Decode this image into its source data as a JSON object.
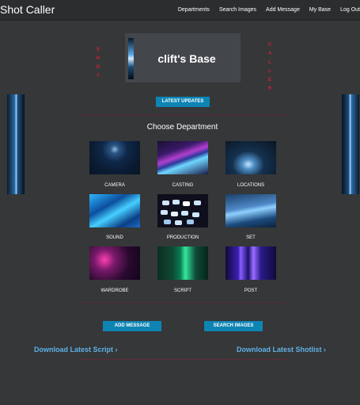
{
  "navbar": {
    "brand": "Shot Caller",
    "links": [
      "Departments",
      "Search Images",
      "Add Message",
      "My Base",
      "Log Out"
    ]
  },
  "side_text": {
    "left": [
      "S",
      "H",
      "O",
      "T"
    ],
    "right": [
      "C",
      "A",
      "L",
      "L",
      "E",
      "R"
    ]
  },
  "base": {
    "title": "clift's Base"
  },
  "buttons": {
    "latest_updates": "LATEST UPDATES",
    "add_message": "ADD MESSAGE",
    "search_images": "SEARCH IMAGES"
  },
  "departments": {
    "heading": "Choose Department",
    "items": [
      {
        "label": "CAMERA"
      },
      {
        "label": "CASTING"
      },
      {
        "label": "LOCATIONS"
      },
      {
        "label": "SOUND"
      },
      {
        "label": "PRODUCTION"
      },
      {
        "label": "SET"
      },
      {
        "label": "WARDROBE"
      },
      {
        "label": "SCRIPT"
      },
      {
        "label": "POST"
      }
    ]
  },
  "downloads": {
    "script": "Download Latest Script",
    "shotlist": "Download Latest Shotlist",
    "chevron": "›"
  },
  "colors": {
    "background": "#353738",
    "navbar": "#2b2d2f",
    "accent_button": "#0e84b4",
    "link": "#5fb1e6",
    "side_text": "#d1213b"
  }
}
